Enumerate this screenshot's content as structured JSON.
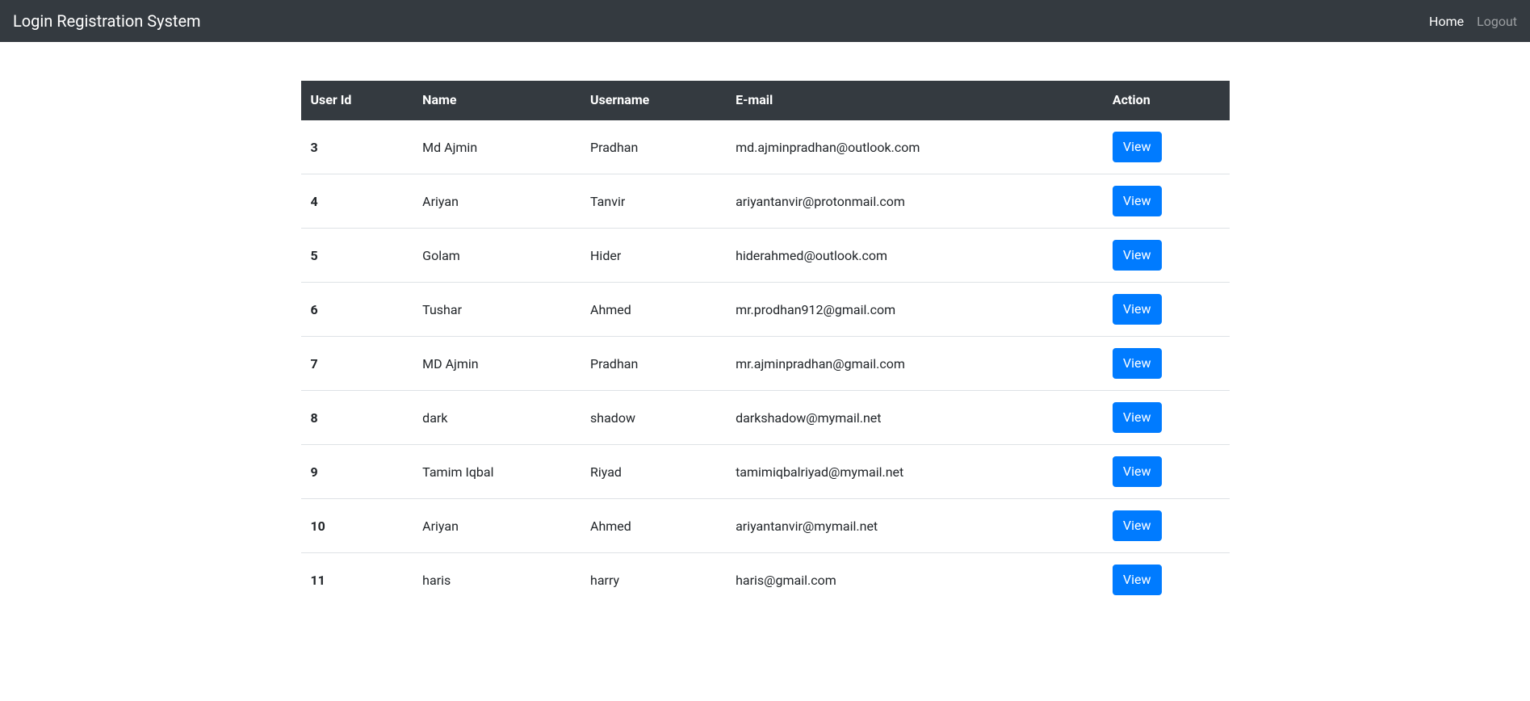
{
  "navbar": {
    "brand": "Login Registration System",
    "links": [
      {
        "label": "Home",
        "active": true
      },
      {
        "label": "Logout",
        "active": false
      }
    ]
  },
  "table": {
    "headers": {
      "user_id": "User Id",
      "name": "Name",
      "username": "Username",
      "email": "E-mail",
      "action": "Action"
    },
    "action_label": "View",
    "rows": [
      {
        "id": "3",
        "name": "Md Ajmin",
        "username": "Pradhan",
        "email": "md.ajminpradhan@outlook.com"
      },
      {
        "id": "4",
        "name": "Ariyan",
        "username": "Tanvir",
        "email": "ariyantanvir@protonmail.com"
      },
      {
        "id": "5",
        "name": "Golam",
        "username": "Hider",
        "email": "hiderahmed@outlook.com"
      },
      {
        "id": "6",
        "name": "Tushar",
        "username": "Ahmed",
        "email": "mr.prodhan912@gmail.com"
      },
      {
        "id": "7",
        "name": "MD Ajmin",
        "username": "Pradhan",
        "email": "mr.ajminpradhan@gmail.com"
      },
      {
        "id": "8",
        "name": "dark",
        "username": "shadow",
        "email": "darkshadow@mymail.net"
      },
      {
        "id": "9",
        "name": "Tamim Iqbal",
        "username": "Riyad",
        "email": "tamimiqbalriyad@mymail.net"
      },
      {
        "id": "10",
        "name": "Ariyan",
        "username": "Ahmed",
        "email": "ariyantanvir@mymail.net"
      },
      {
        "id": "11",
        "name": "haris",
        "username": "harry",
        "email": "haris@gmail.com"
      }
    ]
  }
}
